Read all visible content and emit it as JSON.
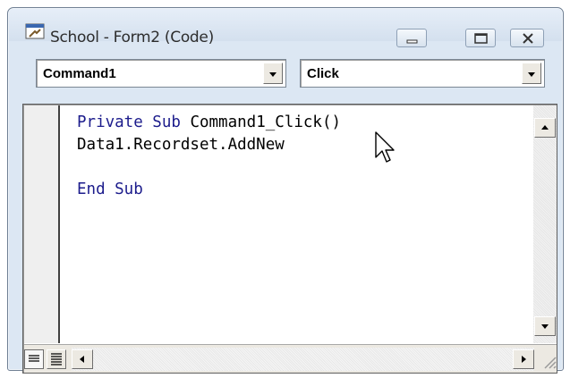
{
  "window": {
    "title": "School - Form2 (Code)"
  },
  "object_combo": {
    "selected": "Command1"
  },
  "procedure_combo": {
    "selected": "Click"
  },
  "code": {
    "lines": [
      [
        {
          "text": "Private Sub ",
          "kw": true
        },
        {
          "text": "Command1_Click()",
          "kw": false
        }
      ],
      [
        {
          "text": "Data1.Recordset.AddNew",
          "kw": false
        }
      ],
      [],
      [
        {
          "text": "End Sub",
          "kw": true
        }
      ]
    ]
  },
  "colors": {
    "keyword": "#1c1c8c",
    "window_frame": "#dce7f3"
  }
}
